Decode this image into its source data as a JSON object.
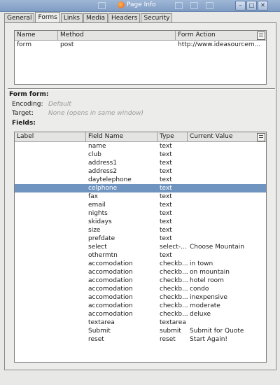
{
  "window": {
    "title": "Page Info"
  },
  "tabs": [
    {
      "label": "General"
    },
    {
      "label": "Forms"
    },
    {
      "label": "Links"
    },
    {
      "label": "Media"
    },
    {
      "label": "Headers"
    },
    {
      "label": "Security"
    }
  ],
  "forms_table": {
    "columns": [
      "Name",
      "Method",
      "Form Action"
    ],
    "rows": [
      {
        "name": "form",
        "method": "post",
        "action": "http://www.ideasourcem..."
      }
    ]
  },
  "form_details": {
    "form_label": "Form form:",
    "encoding_label": "Encoding:",
    "encoding_value": "Default",
    "target_label": "Target:",
    "target_value": "None (opens in same window)",
    "fields_label": "Fields:"
  },
  "fields_table": {
    "columns": [
      "Label",
      "Field Name",
      "Type",
      "Current Value"
    ],
    "selected_index": 5,
    "rows": [
      {
        "label": "",
        "field": "name",
        "type": "text",
        "value": ""
      },
      {
        "label": "",
        "field": "club",
        "type": "text",
        "value": ""
      },
      {
        "label": "",
        "field": "address1",
        "type": "text",
        "value": ""
      },
      {
        "label": "",
        "field": "address2",
        "type": "text",
        "value": ""
      },
      {
        "label": "",
        "field": "daytelephone",
        "type": "text",
        "value": ""
      },
      {
        "label": "",
        "field": "celphone",
        "type": "text",
        "value": ""
      },
      {
        "label": "",
        "field": "fax",
        "type": "text",
        "value": ""
      },
      {
        "label": "",
        "field": "email",
        "type": "text",
        "value": ""
      },
      {
        "label": "",
        "field": "nights",
        "type": "text",
        "value": ""
      },
      {
        "label": "",
        "field": "skidays",
        "type": "text",
        "value": ""
      },
      {
        "label": "",
        "field": "size",
        "type": "text",
        "value": ""
      },
      {
        "label": "",
        "field": "prefdate",
        "type": "text",
        "value": ""
      },
      {
        "label": "",
        "field": "select",
        "type": "select-...",
        "value": "Choose Mountain"
      },
      {
        "label": "",
        "field": "othermtn",
        "type": "text",
        "value": ""
      },
      {
        "label": "",
        "field": "accomodation",
        "type": "checkb...",
        "value": "in town"
      },
      {
        "label": "",
        "field": "accomodation",
        "type": "checkb...",
        "value": "on mountain"
      },
      {
        "label": "",
        "field": "accomodation",
        "type": "checkb...",
        "value": "hotel room"
      },
      {
        "label": "",
        "field": "accomodation",
        "type": "checkb...",
        "value": "condo"
      },
      {
        "label": "",
        "field": "accomodation",
        "type": "checkb...",
        "value": "inexpensive"
      },
      {
        "label": "",
        "field": "accomodation",
        "type": "checkb...",
        "value": "moderate"
      },
      {
        "label": "",
        "field": "accomodation",
        "type": "checkb...",
        "value": "deluxe"
      },
      {
        "label": "",
        "field": "textarea",
        "type": "textarea",
        "value": ""
      },
      {
        "label": "",
        "field": "Submit",
        "type": "submit",
        "value": "Submit for Quote"
      },
      {
        "label": "",
        "field": "reset",
        "type": "reset",
        "value": "Start Again!"
      }
    ]
  },
  "colors": {
    "selection": "#6f94bf",
    "titlebar": "#8aa6cc"
  },
  "icons": [
    "firefox-icon",
    "minimize-icon",
    "maximize-icon",
    "close-icon",
    "column-picker-icon"
  ]
}
